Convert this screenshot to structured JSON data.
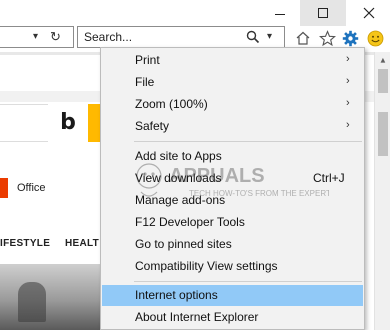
{
  "toolbar": {
    "search_placeholder": "Search...",
    "address_dropdown_glyph": "▾",
    "refresh_glyph": "↻",
    "search_dropdown_glyph": "▾",
    "icons": [
      "home-icon",
      "favorites-star-icon",
      "tools-gear-icon",
      "feedback-smiley-icon"
    ]
  },
  "window_controls": [
    "minimize",
    "maximize",
    "close"
  ],
  "page": {
    "search_brand": "b",
    "office_label": "Office",
    "nav_lifestyle": "IFESTYLE",
    "nav_health": "HEALT"
  },
  "menu": {
    "items": [
      {
        "label": "Print",
        "submenu": true
      },
      {
        "label": "File",
        "submenu": true
      },
      {
        "label": "Zoom (100%)",
        "submenu": true
      },
      {
        "label": "Safety",
        "submenu": true
      },
      {
        "label": "Add site to Apps"
      },
      {
        "label": "View downloads",
        "shortcut": "Ctrl+J"
      },
      {
        "label": "Manage add-ons"
      },
      {
        "label": "F12 Developer Tools"
      },
      {
        "label": "Go to pinned sites"
      },
      {
        "label": "Compatibility View settings"
      },
      {
        "label": "Internet options",
        "highlighted": true
      },
      {
        "label": "About Internet Explorer"
      }
    ],
    "submenu_arrow": "›"
  },
  "watermark": {
    "brand": "APPUALS",
    "tagline": "TECH HOW-TO'S FROM THE EXPERTS!"
  },
  "colors": {
    "highlight": "#91c9f7",
    "gear_blue": "#1e73be",
    "smiley_yellow": "#f5c518",
    "office_red": "#eb3c00",
    "bing_yellow": "#ffb900"
  }
}
